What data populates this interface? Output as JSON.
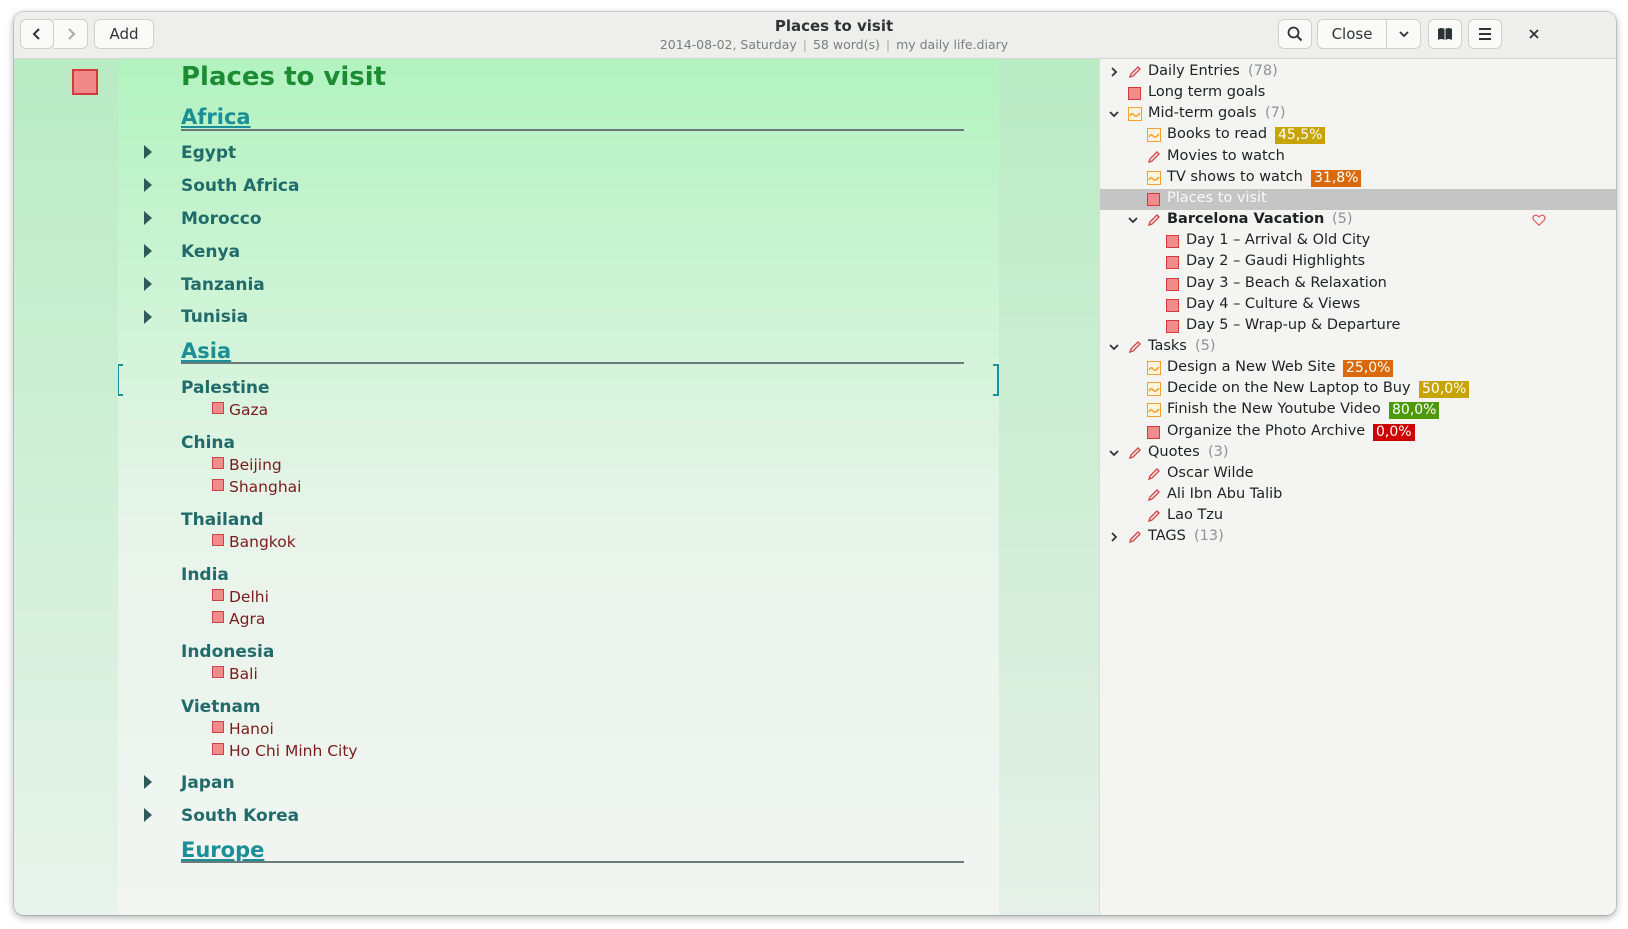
{
  "header": {
    "back_icon": "chevron-left-icon",
    "forward_icon": "chevron-right-icon",
    "add_label": "Add",
    "title": "Places to visit",
    "date": "2014-08-02, Saturday",
    "word_count": "58 word(s)",
    "diary_file": "my daily life.diary",
    "search_icon": "search-icon",
    "close_label": "Close",
    "close_menu_icon": "chevron-down-icon",
    "book_icon": "book-icon",
    "menu_icon": "hamburger-icon",
    "window_close_icon": "close-icon"
  },
  "editor": {
    "title": "Places to visit",
    "sections": [
      {
        "heading": "Africa",
        "countries": [
          "Egypt",
          "South Africa",
          "Morocco",
          "Kenya",
          "Tanzania",
          "Tunisia"
        ]
      },
      {
        "heading": "Asia",
        "countries": [
          {
            "name": "Palestine",
            "cities": [
              "Gaza"
            ]
          },
          {
            "name": "China",
            "cities": [
              "Beijing",
              "Shanghai"
            ]
          },
          {
            "name": "Thailand",
            "cities": [
              "Bangkok"
            ]
          },
          {
            "name": "India",
            "cities": [
              "Delhi",
              "Agra"
            ]
          },
          {
            "name": "Indonesia",
            "cities": [
              "Bali"
            ]
          },
          {
            "name": "Vietnam",
            "cities": [
              "Hanoi",
              "Ho Chi Minh City"
            ]
          },
          {
            "name": "Japan",
            "collapsed": true
          },
          {
            "name": "South Korea",
            "collapsed": true
          }
        ]
      },
      {
        "heading": "Europe"
      }
    ]
  },
  "sidebar": {
    "items": [
      {
        "label": "Daily Entries",
        "count": "(78)",
        "icon": "pencil-icon",
        "expander": "collapsed"
      },
      {
        "label": "Long term goals",
        "icon": "todo-square-icon"
      },
      {
        "label": "Mid-term goals",
        "count": "(7)",
        "icon": "progress-icon",
        "expander": "expanded"
      },
      {
        "label": "Books to read",
        "icon": "progress-icon",
        "progress": "45,5%",
        "progress_color": "#c8a400"
      },
      {
        "label": "Movies to watch",
        "icon": "pencil-icon"
      },
      {
        "label": "TV shows to watch",
        "icon": "progress-icon",
        "progress": "31,8%",
        "progress_color": "#d9690a"
      },
      {
        "label": "Places to visit",
        "icon": "todo-square-icon",
        "selected": true
      },
      {
        "label": "Barcelona Vacation",
        "count": "(5)",
        "icon": "pencil-icon",
        "expander": "expanded",
        "favorite_icon": "heart-icon"
      },
      {
        "label": "Day 1 – Arrival & Old City",
        "icon": "todo-square-icon"
      },
      {
        "label": "Day 2 – Gaudi Highlights",
        "icon": "todo-square-icon"
      },
      {
        "label": "Day 3 – Beach & Relaxation",
        "icon": "todo-square-icon"
      },
      {
        "label": "Day 4 – Culture & Views",
        "icon": "todo-square-icon"
      },
      {
        "label": "Day 5 – Wrap-up & Departure",
        "icon": "todo-square-icon"
      },
      {
        "label": "Tasks",
        "count": "(5)",
        "icon": "pencil-icon",
        "expander": "expanded"
      },
      {
        "label": "Design a New Web Site",
        "icon": "progress-icon",
        "progress": "25,0%",
        "progress_color": "#d9690a"
      },
      {
        "label": "Decide on the New Laptop to Buy",
        "icon": "progress-icon",
        "progress": "50,0%",
        "progress_color": "#c8a400"
      },
      {
        "label": "Finish the New Youtube Video",
        "icon": "progress-icon",
        "progress": "80,0%",
        "progress_color": "#4e9a06"
      },
      {
        "label": "Organize the Photo Archive",
        "icon": "todo-square-icon",
        "progress": "0,0%",
        "progress_color": "#cc0000"
      },
      {
        "label": "Quotes",
        "count": "(3)",
        "icon": "pencil-icon",
        "expander": "expanded"
      },
      {
        "label": "Oscar Wilde",
        "icon": "pencil-icon"
      },
      {
        "label": "Ali Ibn Abu Talib",
        "icon": "pencil-icon"
      },
      {
        "label": "Lao Tzu",
        "icon": "pencil-icon"
      },
      {
        "label": "TAGS",
        "count": "(13)",
        "icon": "pencil-icon",
        "expander": "collapsed"
      }
    ]
  },
  "colors": {
    "title_green": "#1c8c32",
    "heading_teal": "#1a8f95",
    "country_teal": "#216b6a",
    "city_red": "#7a1c1c",
    "todo_red": "#f28b8b",
    "progress_orange": "#f5a030"
  }
}
